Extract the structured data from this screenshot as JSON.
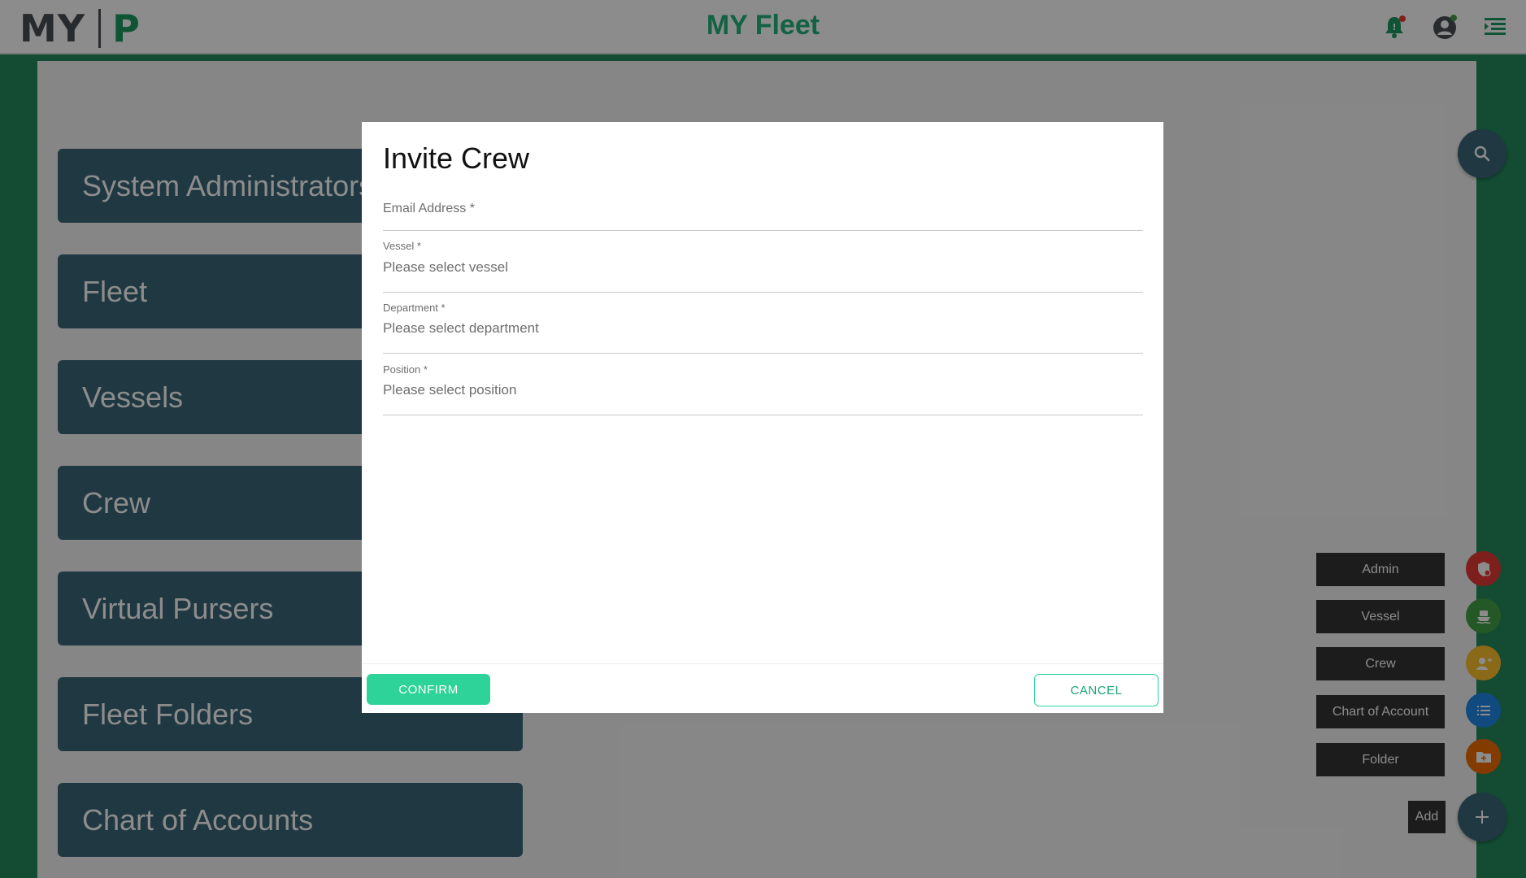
{
  "header": {
    "logo_left": "MY",
    "logo_right": "P",
    "title": "MY Fleet",
    "icons": [
      "bell-icon",
      "user-account-icon",
      "menu-toggle-icon"
    ]
  },
  "menu": [
    {
      "label": "System Administrators"
    },
    {
      "label": "Fleet"
    },
    {
      "label": "Vessels"
    },
    {
      "label": "Crew"
    },
    {
      "label": "Virtual Pursers"
    },
    {
      "label": "Fleet Folders"
    },
    {
      "label": "Chart of Accounts"
    }
  ],
  "fab_actions": [
    {
      "label": "Admin",
      "icon": "shield-icon",
      "color": "#e53935"
    },
    {
      "label": "Vessel",
      "icon": "ferry-icon",
      "color": "#43a047"
    },
    {
      "label": "Crew",
      "icon": "add-person-icon",
      "color": "#fbc02d"
    },
    {
      "label": "Chart of Account",
      "icon": "list-icon",
      "color": "#1e88e5"
    },
    {
      "label": "Folder",
      "icon": "add-folder-icon",
      "color": "#ef6c00"
    }
  ],
  "fab_add_label": "Add",
  "modal": {
    "title": "Invite Crew",
    "fields": {
      "email": {
        "placeholder": "Email Address *"
      },
      "vessel": {
        "label": "Vessel *",
        "placeholder": "Please select vessel"
      },
      "department": {
        "label": "Department *",
        "placeholder": "Please select department"
      },
      "position": {
        "label": "Position *",
        "placeholder": "Please select position"
      }
    },
    "confirm_label": "CONFIRM",
    "cancel_label": "CANCEL"
  },
  "colors": {
    "brand_green": "#21b37a",
    "card_blue": "#3a6679",
    "confirm_green": "#2ed39a"
  }
}
